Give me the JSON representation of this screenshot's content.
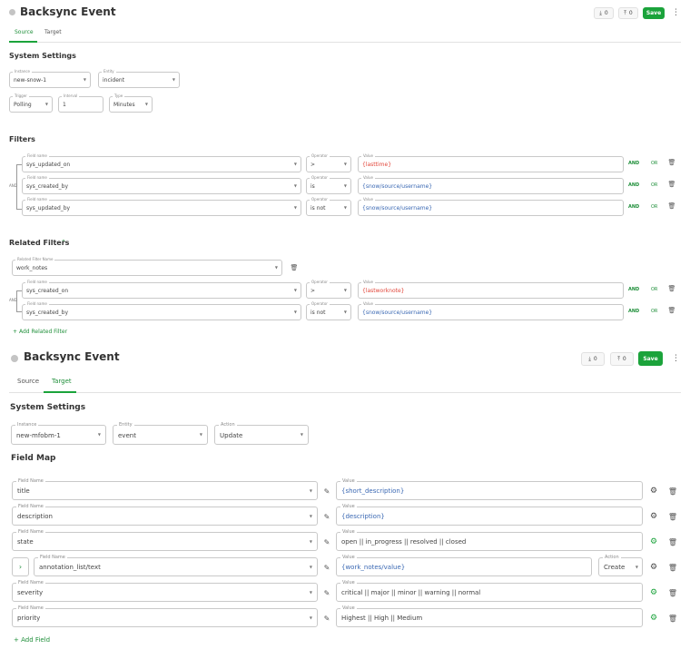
{
  "top": {
    "title": "Backsync Event",
    "download_count": "0",
    "upload_count": "0",
    "save_label": "Save",
    "more_label": "⋮",
    "tabs": [
      "Source",
      "Target"
    ],
    "active_tab": "Source",
    "system_settings_heading": "System Settings",
    "instance": {
      "label": "Instance",
      "value": "new-snow-1"
    },
    "entity": {
      "label": "Entity",
      "value": "incident"
    },
    "trigger": {
      "label": "Trigger",
      "value": "Polling"
    },
    "interval": {
      "label": "Interval",
      "value": "1"
    },
    "type": {
      "label": "Type",
      "value": "Minutes"
    },
    "filters_heading": "Filters",
    "field_name_label": "Field name",
    "operator_label": "Operator",
    "value_label": "Value",
    "and_label": "AND",
    "or_label": "OR",
    "group_connector": "AND",
    "filters": [
      {
        "field": "sys_updated_on",
        "operator": ">",
        "value": "{lasttime}",
        "value_color": "#e2473b"
      },
      {
        "field": "sys_created_by",
        "operator": "is",
        "value": "{snow/source/username}",
        "value_color": "#3a68b3"
      },
      {
        "field": "sys_updated_by",
        "operator": "is not",
        "value": "{snow/source/username}",
        "value_color": "#3a68b3"
      }
    ],
    "related_filters_heading": "Related Filters",
    "related_filter_name": {
      "label": "Related Filter Name",
      "value": "work_notes"
    },
    "related_filters": [
      {
        "field": "sys_created_on",
        "operator": ">",
        "value": "{lastworknote}",
        "value_color": "#e2473b"
      },
      {
        "field": "sys_created_by",
        "operator": "is not",
        "value": "{snow/source/username}",
        "value_color": "#3a68b3"
      }
    ],
    "add_related_filter_label": "Add Related Filter"
  },
  "bottom": {
    "title": "Backsync Event",
    "download_count": "0",
    "upload_count": "0",
    "save_label": "Save",
    "more_label": "⋮",
    "tabs": [
      "Source",
      "Target"
    ],
    "active_tab": "Target",
    "system_settings_heading": "System Settings",
    "instance": {
      "label": "Instance",
      "value": "new-mfobm-1"
    },
    "entity": {
      "label": "Entity",
      "value": "event"
    },
    "action": {
      "label": "Action",
      "value": "Update"
    },
    "field_map_heading": "Field Map",
    "field_name_label": "Field Name",
    "value_label": "Value",
    "action_label": "Action",
    "field_map": [
      {
        "field": "title",
        "value": "{short_description}",
        "value_color": "#3a68b3",
        "gear_active": false
      },
      {
        "field": "description",
        "value": "{description}",
        "value_color": "#3a68b3",
        "gear_active": false
      },
      {
        "field": "state",
        "value": "open || in_progress || resolved || closed",
        "value_color": "#555555",
        "gear_active": true
      },
      {
        "field": "annotation_list/text",
        "value": "{work_notes/value}",
        "value_color": "#3a68b3",
        "gear_active": false,
        "expandable": true,
        "action": "Create"
      },
      {
        "field": "severity",
        "value": "critical || major || minor || warning || normal",
        "value_color": "#555555",
        "gear_active": true
      },
      {
        "field": "priority",
        "value": "Highest || High || Medium",
        "value_color": "#555555",
        "gear_active": true
      }
    ],
    "add_field_label": "Add Field"
  },
  "colors": {
    "accent": "#1ba33b",
    "variable_red": "#e2473b",
    "variable_blue": "#3a68b3"
  },
  "icons": [
    "download-icon",
    "upload-icon",
    "more-icon",
    "chevron-down-icon",
    "trash-icon",
    "gear-icon",
    "edit-icon",
    "chevron-up-icon",
    "plus-icon",
    "chevron-right-icon"
  ]
}
